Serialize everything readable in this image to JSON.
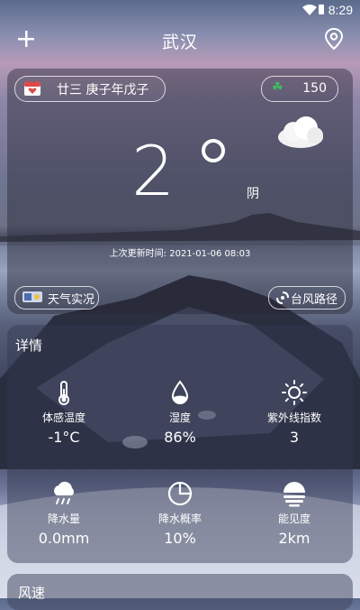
{
  "status_bar": {
    "time": "8:29"
  },
  "header": {
    "city": "武汉"
  },
  "now": {
    "lunar_date": "廿三 庚子年戊子",
    "aqi": "150",
    "temperature": "2",
    "weather": "阴",
    "update_label": "上次更新时间:",
    "update_time": "2021-01-06 08:03",
    "live_label": "天气实况",
    "typhoon_label": "台风路径"
  },
  "details": {
    "title": "详情",
    "items": [
      {
        "icon": "thermometer-icon",
        "label": "体感温度",
        "value": "-1°C"
      },
      {
        "icon": "humidity-icon",
        "label": "湿度",
        "value": "86%"
      },
      {
        "icon": "sun-icon",
        "label": "紫外线指数",
        "value": "3"
      },
      {
        "icon": "rain-cloud-icon",
        "label": "降水量",
        "value": "0.0mm"
      },
      {
        "icon": "pie-chart-icon",
        "label": "降水概率",
        "value": "10%"
      },
      {
        "icon": "fog-icon",
        "label": "能见度",
        "value": "2km"
      }
    ]
  },
  "wind": {
    "title": "风速"
  }
}
